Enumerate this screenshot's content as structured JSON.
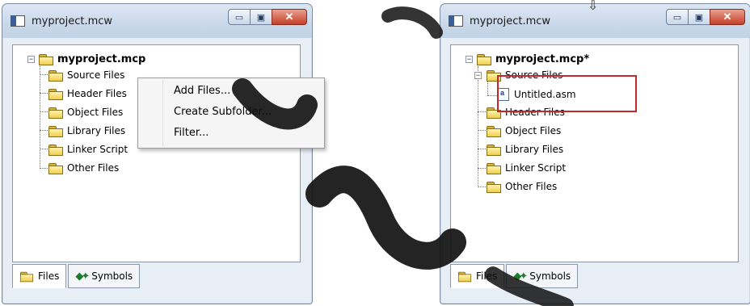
{
  "left_window": {
    "title": "myproject.mcw",
    "tree": {
      "root": "myproject.mcp",
      "folders": [
        "Source Files",
        "Header Files",
        "Object Files",
        "Library Files",
        "Linker Script",
        "Other Files"
      ]
    },
    "tabs": [
      {
        "label": "Files"
      },
      {
        "label": "Symbols"
      }
    ],
    "context_menu": [
      "Add Files...",
      "Create Subfolder...",
      "Filter..."
    ]
  },
  "right_window": {
    "title": "myproject.mcw",
    "tree": {
      "root": "myproject.mcp*",
      "source_folder": "Source Files",
      "source_child": "Untitled.asm",
      "other_folders": [
        "Header Files",
        "Object Files",
        "Library Files",
        "Linker Script",
        "Other Files"
      ]
    },
    "tabs": [
      {
        "label": "Files"
      },
      {
        "label": "Symbols"
      }
    ]
  },
  "caption_buttons": {
    "minimize": "▭",
    "maximize": "▣",
    "close": "✕"
  },
  "icons": {
    "project": "folder-icon",
    "file": "asm-file-icon",
    "symbols": "symbols-icon",
    "cursor": "cursor-arrow-icon"
  },
  "colors": {
    "highlight": "#c0282c",
    "watermark": "#111111"
  }
}
